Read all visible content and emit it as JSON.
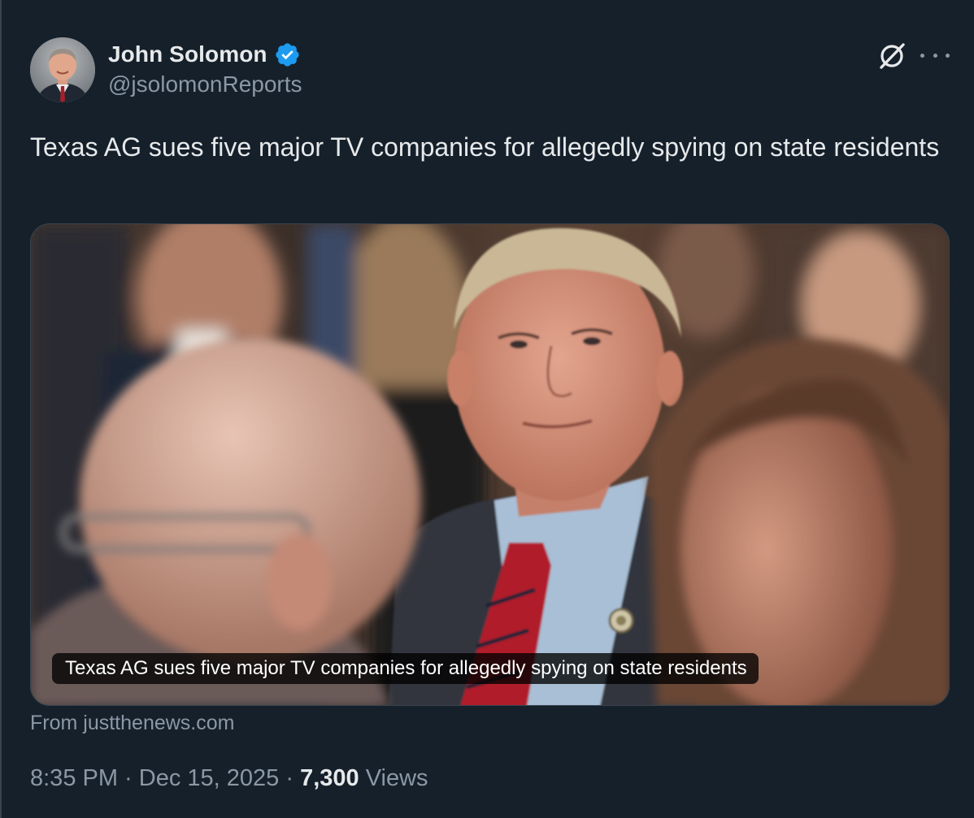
{
  "author": {
    "display_name": "John Solomon",
    "handle": "@jsolomonReports",
    "verified": true,
    "verified_badge_color": "#1d9bf0"
  },
  "actions": {
    "grok_icon": "grok-icon",
    "more_icon": "more-horizontal-icon"
  },
  "tweet": {
    "text": "Texas AG sues five major TV companies for allegedly spying on state residents"
  },
  "media": {
    "caption": "Texas AG sues five major TV companies for allegedly spying on state residents"
  },
  "link_source": {
    "prefix": "From ",
    "domain": "justthenews.com"
  },
  "meta": {
    "time": "8:35 PM",
    "separator": " · ",
    "date": "Dec 15, 2025",
    "views_count": "7,300",
    "views_label": " Views"
  },
  "colors": {
    "background": "#15202b",
    "text_primary": "#e7e9ea",
    "text_secondary": "#8b98a5",
    "border": "#38444d"
  }
}
